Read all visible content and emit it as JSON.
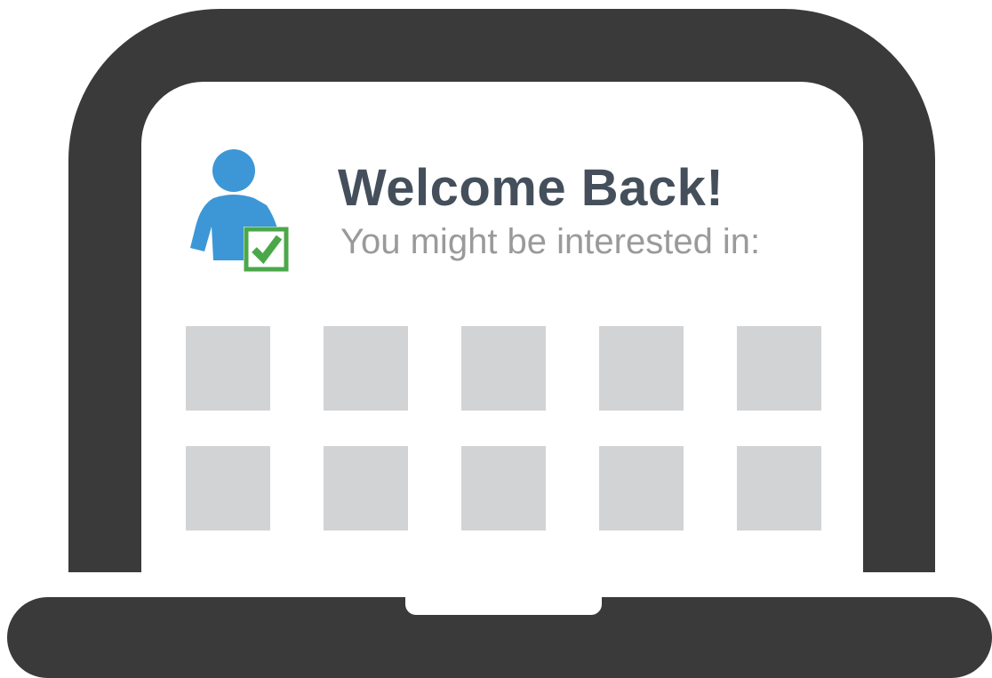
{
  "header": {
    "title": "Welcome Back!",
    "subtitle": "You might be interested in:"
  },
  "icons": {
    "user": "user-icon",
    "check": "checkbox-check-icon"
  },
  "colors": {
    "device": "#3a3a3a",
    "screen": "#ffffff",
    "title": "#444f5b",
    "subtitle": "#9a9a9a",
    "user_icon": "#3d97d6",
    "check": "#4aa84a",
    "tile": "#d2d3d5"
  },
  "recommendations": {
    "rows": 2,
    "columns": 5
  }
}
